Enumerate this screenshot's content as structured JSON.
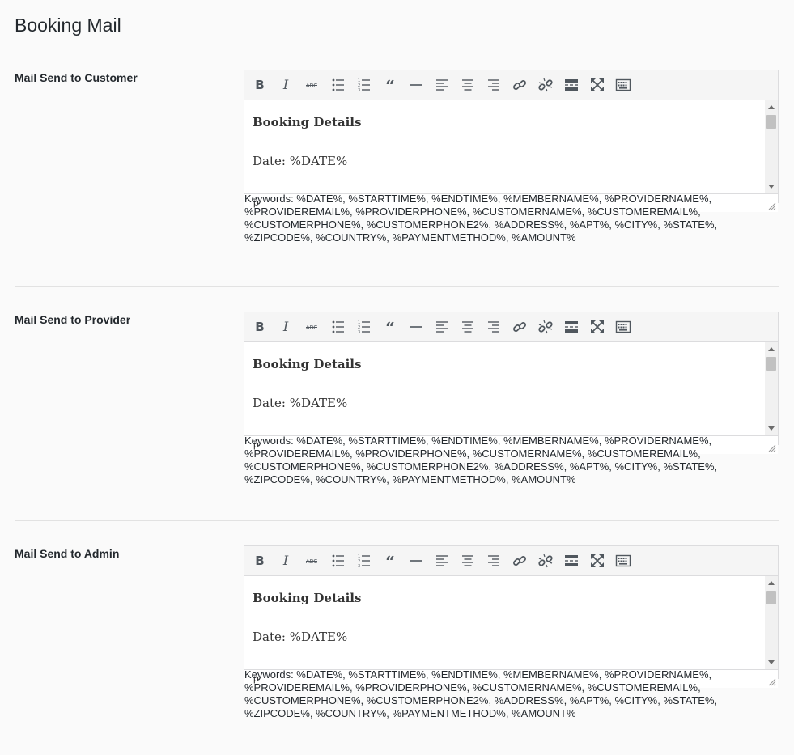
{
  "page": {
    "title": "Booking Mail"
  },
  "toolbar_icons": [
    {
      "name": "bold-icon"
    },
    {
      "name": "italic-icon"
    },
    {
      "name": "strikethrough-icon"
    },
    {
      "name": "bullet-list-icon"
    },
    {
      "name": "numbered-list-icon"
    },
    {
      "name": "blockquote-icon"
    },
    {
      "name": "horizontal-line-icon"
    },
    {
      "name": "align-left-icon"
    },
    {
      "name": "align-center-icon"
    },
    {
      "name": "align-right-icon"
    },
    {
      "name": "link-icon"
    },
    {
      "name": "unlink-icon"
    },
    {
      "name": "read-more-icon"
    },
    {
      "name": "fullscreen-icon"
    },
    {
      "name": "toolbar-toggle-icon"
    }
  ],
  "sections": [
    {
      "label": "Mail Send to Customer",
      "editor": {
        "heading": "Booking Details",
        "line": "Date: %DATE%",
        "path": "p"
      },
      "keywords": "Keywords: %DATE%, %STARTTIME%, %ENDTIME%, %MEMBERNAME%, %PROVIDERNAME%, %PROVIDEREMAIL%, %PROVIDERPHONE%, %CUSTOMERNAME%, %CUSTOMEREMAIL%, %CUSTOMERPHONE%, %CUSTOMERPHONE2%, %ADDRESS%, %APT%, %CITY%, %STATE%, %ZIPCODE%, %COUNTRY%, %PAYMENTMETHOD%, %AMOUNT%"
    },
    {
      "label": "Mail Send to Provider",
      "editor": {
        "heading": "Booking Details",
        "line": "Date: %DATE%",
        "path": "p"
      },
      "keywords": "Keywords: %DATE%, %STARTTIME%, %ENDTIME%, %MEMBERNAME%, %PROVIDERNAME%, %PROVIDEREMAIL%, %PROVIDERPHONE%, %CUSTOMERNAME%, %CUSTOMEREMAIL%, %CUSTOMERPHONE%, %CUSTOMERPHONE2%, %ADDRESS%, %APT%, %CITY%, %STATE%, %ZIPCODE%, %COUNTRY%, %PAYMENTMETHOD%, %AMOUNT%"
    },
    {
      "label": "Mail Send to Admin",
      "editor": {
        "heading": "Booking Details",
        "line": "Date: %DATE%",
        "path": "p"
      },
      "keywords": "Keywords: %DATE%, %STARTTIME%, %ENDTIME%, %MEMBERNAME%, %PROVIDERNAME%, %PROVIDEREMAIL%, %PROVIDERPHONE%, %CUSTOMERNAME%, %CUSTOMEREMAIL%, %CUSTOMERPHONE%, %CUSTOMERPHONE2%, %ADDRESS%, %APT%, %CITY%, %STATE%, %ZIPCODE%, %COUNTRY%, %PAYMENTMETHOD%, %AMOUNT%"
    }
  ]
}
